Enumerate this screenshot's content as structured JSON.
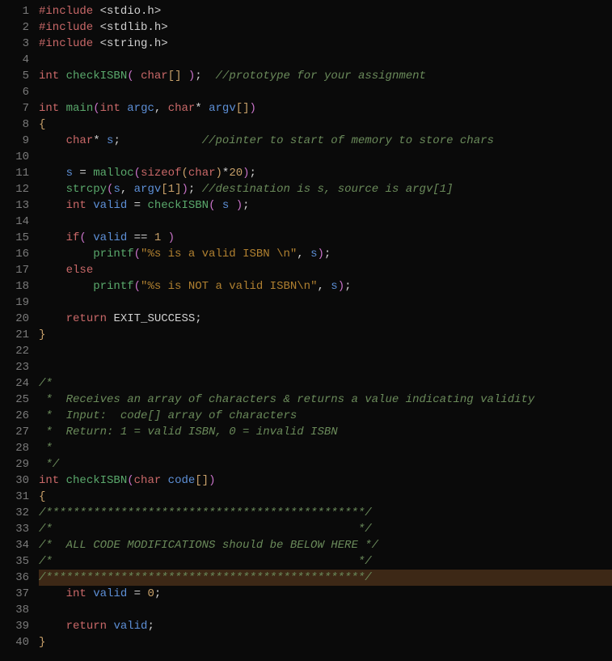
{
  "lines": [
    {
      "n": 1,
      "hl": false,
      "tokens": [
        [
          "pp",
          "#include"
        ],
        [
          "op",
          " "
        ],
        [
          "inc",
          "<stdio.h>"
        ]
      ]
    },
    {
      "n": 2,
      "hl": false,
      "tokens": [
        [
          "pp",
          "#include"
        ],
        [
          "op",
          " "
        ],
        [
          "inc",
          "<stdlib.h>"
        ]
      ]
    },
    {
      "n": 3,
      "hl": false,
      "tokens": [
        [
          "pp",
          "#include"
        ],
        [
          "op",
          " "
        ],
        [
          "inc",
          "<string.h>"
        ]
      ]
    },
    {
      "n": 4,
      "hl": false,
      "tokens": []
    },
    {
      "n": 5,
      "hl": false,
      "tokens": [
        [
          "kw",
          "int"
        ],
        [
          "op",
          " "
        ],
        [
          "fn",
          "checkISBN"
        ],
        [
          "pmagenta",
          "("
        ],
        [
          "op",
          " "
        ],
        [
          "kw",
          "char"
        ],
        [
          "pyellow",
          "[]"
        ],
        [
          "op",
          " "
        ],
        [
          "pmagenta",
          ")"
        ],
        [
          "op",
          ";  "
        ],
        [
          "cm",
          "//prototype for your assignment"
        ]
      ]
    },
    {
      "n": 6,
      "hl": false,
      "tokens": []
    },
    {
      "n": 7,
      "hl": false,
      "tokens": [
        [
          "kw",
          "int"
        ],
        [
          "op",
          " "
        ],
        [
          "fn",
          "main"
        ],
        [
          "pmagenta",
          "("
        ],
        [
          "kw",
          "int"
        ],
        [
          "op",
          " "
        ],
        [
          "id",
          "argc"
        ],
        [
          "op",
          ", "
        ],
        [
          "kw",
          "char"
        ],
        [
          "op",
          "* "
        ],
        [
          "id",
          "argv"
        ],
        [
          "pyellow",
          "[]"
        ],
        [
          "pmagenta",
          ")"
        ]
      ]
    },
    {
      "n": 8,
      "hl": false,
      "tokens": [
        [
          "brace",
          "{"
        ]
      ]
    },
    {
      "n": 9,
      "hl": false,
      "tokens": [
        [
          "op",
          "    "
        ],
        [
          "kw",
          "char"
        ],
        [
          "op",
          "* "
        ],
        [
          "id",
          "s"
        ],
        [
          "op",
          ";            "
        ],
        [
          "cm",
          "//pointer to start of memory to store chars"
        ]
      ]
    },
    {
      "n": 10,
      "hl": false,
      "tokens": []
    },
    {
      "n": 11,
      "hl": false,
      "tokens": [
        [
          "op",
          "    "
        ],
        [
          "id",
          "s"
        ],
        [
          "op",
          " = "
        ],
        [
          "fn",
          "malloc"
        ],
        [
          "pmagenta",
          "("
        ],
        [
          "kw",
          "sizeof"
        ],
        [
          "pyellow",
          "("
        ],
        [
          "kw",
          "char"
        ],
        [
          "pyellow",
          ")"
        ],
        [
          "op",
          "*"
        ],
        [
          "num",
          "20"
        ],
        [
          "pmagenta",
          ")"
        ],
        [
          "op",
          ";"
        ]
      ]
    },
    {
      "n": 12,
      "hl": false,
      "tokens": [
        [
          "op",
          "    "
        ],
        [
          "fn",
          "strcpy"
        ],
        [
          "pmagenta",
          "("
        ],
        [
          "id",
          "s"
        ],
        [
          "op",
          ", "
        ],
        [
          "id",
          "argv"
        ],
        [
          "pyellow",
          "["
        ],
        [
          "num",
          "1"
        ],
        [
          "pyellow",
          "]"
        ],
        [
          "pmagenta",
          ")"
        ],
        [
          "op",
          "; "
        ],
        [
          "cm",
          "//destination is s, source is argv[1]"
        ]
      ]
    },
    {
      "n": 13,
      "hl": false,
      "tokens": [
        [
          "op",
          "    "
        ],
        [
          "kw",
          "int"
        ],
        [
          "op",
          " "
        ],
        [
          "id",
          "valid"
        ],
        [
          "op",
          " = "
        ],
        [
          "fn",
          "checkISBN"
        ],
        [
          "pmagenta",
          "("
        ],
        [
          "op",
          " "
        ],
        [
          "id",
          "s"
        ],
        [
          "op",
          " "
        ],
        [
          "pmagenta",
          ")"
        ],
        [
          "op",
          ";"
        ]
      ]
    },
    {
      "n": 14,
      "hl": false,
      "tokens": []
    },
    {
      "n": 15,
      "hl": false,
      "tokens": [
        [
          "op",
          "    "
        ],
        [
          "kw",
          "if"
        ],
        [
          "pmagenta",
          "("
        ],
        [
          "op",
          " "
        ],
        [
          "id",
          "valid"
        ],
        [
          "op",
          " == "
        ],
        [
          "num",
          "1"
        ],
        [
          "op",
          " "
        ],
        [
          "pmagenta",
          ")"
        ]
      ]
    },
    {
      "n": 16,
      "hl": false,
      "tokens": [
        [
          "op",
          "        "
        ],
        [
          "fn",
          "printf"
        ],
        [
          "pmagenta",
          "("
        ],
        [
          "str",
          "\"%s is a valid ISBN \\n\""
        ],
        [
          "op",
          ", "
        ],
        [
          "id",
          "s"
        ],
        [
          "pmagenta",
          ")"
        ],
        [
          "op",
          ";"
        ]
      ]
    },
    {
      "n": 17,
      "hl": false,
      "tokens": [
        [
          "op",
          "    "
        ],
        [
          "kw",
          "else"
        ]
      ]
    },
    {
      "n": 18,
      "hl": false,
      "tokens": [
        [
          "op",
          "        "
        ],
        [
          "fn",
          "printf"
        ],
        [
          "pmagenta",
          "("
        ],
        [
          "str",
          "\"%s is NOT a valid ISBN\\n\""
        ],
        [
          "op",
          ", "
        ],
        [
          "id",
          "s"
        ],
        [
          "pmagenta",
          ")"
        ],
        [
          "op",
          ";"
        ]
      ]
    },
    {
      "n": 19,
      "hl": false,
      "tokens": []
    },
    {
      "n": 20,
      "hl": false,
      "tokens": [
        [
          "op",
          "    "
        ],
        [
          "kw",
          "return"
        ],
        [
          "op",
          " "
        ],
        [
          "const",
          "EXIT_SUCCESS"
        ],
        [
          "op",
          ";"
        ]
      ]
    },
    {
      "n": 21,
      "hl": false,
      "tokens": [
        [
          "brace",
          "}"
        ]
      ]
    },
    {
      "n": 22,
      "hl": false,
      "tokens": []
    },
    {
      "n": 23,
      "hl": false,
      "tokens": []
    },
    {
      "n": 24,
      "hl": false,
      "tokens": [
        [
          "cm",
          "/*"
        ]
      ]
    },
    {
      "n": 25,
      "hl": false,
      "tokens": [
        [
          "cm",
          " *  Receives an array of characters & returns a value indicating validity"
        ]
      ]
    },
    {
      "n": 26,
      "hl": false,
      "tokens": [
        [
          "cm",
          " *  Input:  code[] array of characters"
        ]
      ]
    },
    {
      "n": 27,
      "hl": false,
      "tokens": [
        [
          "cm",
          " *  Return: 1 = valid ISBN, 0 = invalid ISBN"
        ]
      ]
    },
    {
      "n": 28,
      "hl": false,
      "tokens": [
        [
          "cm",
          " *"
        ]
      ]
    },
    {
      "n": 29,
      "hl": false,
      "tokens": [
        [
          "cm",
          " */"
        ]
      ]
    },
    {
      "n": 30,
      "hl": false,
      "tokens": [
        [
          "kw",
          "int"
        ],
        [
          "op",
          " "
        ],
        [
          "fn",
          "checkISBN"
        ],
        [
          "pmagenta",
          "("
        ],
        [
          "kw",
          "char"
        ],
        [
          "op",
          " "
        ],
        [
          "id",
          "code"
        ],
        [
          "pyellow",
          "[]"
        ],
        [
          "pmagenta",
          ")"
        ]
      ]
    },
    {
      "n": 31,
      "hl": false,
      "tokens": [
        [
          "brace",
          "{"
        ]
      ]
    },
    {
      "n": 32,
      "hl": false,
      "tokens": [
        [
          "cm",
          "/***********************************************/"
        ]
      ]
    },
    {
      "n": 33,
      "hl": false,
      "tokens": [
        [
          "cm",
          "/*                                             */"
        ]
      ]
    },
    {
      "n": 34,
      "hl": false,
      "tokens": [
        [
          "cm",
          "/*  ALL CODE MODIFICATIONS should be BELOW HERE */"
        ]
      ]
    },
    {
      "n": 35,
      "hl": false,
      "tokens": [
        [
          "cm",
          "/*                                             */"
        ]
      ]
    },
    {
      "n": 36,
      "hl": true,
      "tokens": [
        [
          "cm",
          "/***********************************************/"
        ]
      ]
    },
    {
      "n": 37,
      "hl": false,
      "tokens": [
        [
          "op",
          "    "
        ],
        [
          "kw",
          "int"
        ],
        [
          "op",
          " "
        ],
        [
          "id",
          "valid"
        ],
        [
          "op",
          " = "
        ],
        [
          "num",
          "0"
        ],
        [
          "op",
          ";"
        ]
      ]
    },
    {
      "n": 38,
      "hl": false,
      "tokens": []
    },
    {
      "n": 39,
      "hl": false,
      "tokens": [
        [
          "op",
          "    "
        ],
        [
          "kw",
          "return"
        ],
        [
          "op",
          " "
        ],
        [
          "id",
          "valid"
        ],
        [
          "op",
          ";"
        ]
      ]
    },
    {
      "n": 40,
      "hl": false,
      "tokens": [
        [
          "brace",
          "}"
        ]
      ]
    }
  ]
}
